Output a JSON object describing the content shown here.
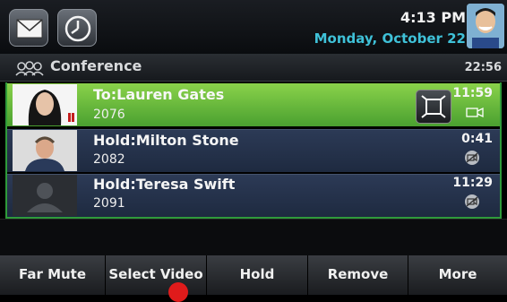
{
  "status": {
    "time": "4:13 PM",
    "date": "Monday, October 22",
    "icons": [
      "envelope-icon",
      "clock-icon"
    ]
  },
  "conference": {
    "title": "Conference",
    "duration": "22:56",
    "icon": "group-icon"
  },
  "calls": [
    {
      "name": "To:Lauren Gates",
      "number": "2076",
      "duration": "11:59",
      "state_color": "#5fb53a"
    },
    {
      "name": "Hold:Milton Stone",
      "number": "2082",
      "duration": "0:41"
    },
    {
      "name": "Hold:Teresa Swift",
      "number": "2091",
      "duration": "11:29"
    }
  ],
  "softkeys": [
    "Far Mute",
    "Select Video",
    "Hold",
    "Remove",
    "More"
  ]
}
